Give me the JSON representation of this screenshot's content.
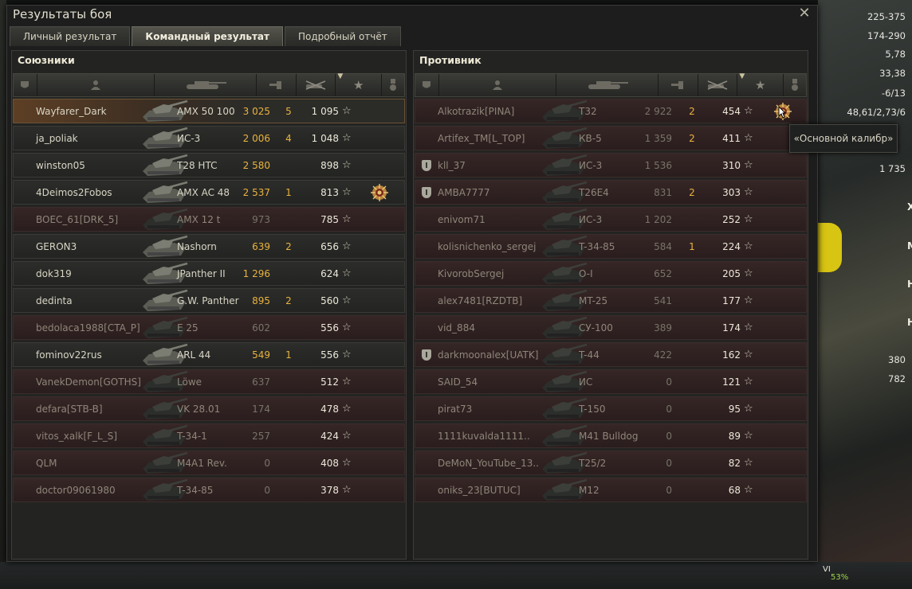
{
  "dialog": {
    "title": "Результаты боя"
  },
  "tabs": [
    {
      "label": "Личный результат",
      "active": false
    },
    {
      "label": "Командный результат",
      "active": true
    },
    {
      "label": "Подробный отчёт",
      "active": false
    }
  ],
  "allies": {
    "title": "Союзники",
    "rows": [
      {
        "name": "Wayfarer_Dark",
        "tank": "AMX 50 100",
        "damage": "3 025",
        "kills": "5",
        "xp": "1 095",
        "status": "me",
        "platoon": false,
        "medal": false
      },
      {
        "name": "ja_poliak",
        "tank": "ИС-3",
        "damage": "2 006",
        "kills": "4",
        "xp": "1 048",
        "status": "alive",
        "platoon": false,
        "medal": false
      },
      {
        "name": "winston05",
        "tank": "T28 HTC",
        "damage": "2 580",
        "kills": "",
        "xp": "898",
        "status": "alive",
        "platoon": false,
        "medal": false
      },
      {
        "name": "4Deimos2Fobos",
        "tank": "AMX AC 48",
        "damage": "2 537",
        "kills": "1",
        "xp": "813",
        "status": "alive",
        "platoon": false,
        "medal": true
      },
      {
        "name": "BOEC_61[DRK_5]",
        "tank": "AMX 12 t",
        "damage": "973",
        "kills": "",
        "xp": "785",
        "status": "dead",
        "platoon": false,
        "medal": false
      },
      {
        "name": "GERON3",
        "tank": "Nashorn",
        "damage": "639",
        "kills": "2",
        "xp": "656",
        "status": "alive",
        "platoon": false,
        "medal": false
      },
      {
        "name": "dok319",
        "tank": "JPanther II",
        "damage": "1 296",
        "kills": "",
        "xp": "624",
        "status": "alive",
        "platoon": false,
        "medal": false
      },
      {
        "name": "dedinta",
        "tank": "G.W. Panther",
        "damage": "895",
        "kills": "2",
        "xp": "560",
        "status": "alive",
        "platoon": false,
        "medal": false
      },
      {
        "name": "bedolaca1988[CTA_P]",
        "tank": "E 25",
        "damage": "602",
        "kills": "",
        "xp": "556",
        "status": "dead",
        "platoon": false,
        "medal": false
      },
      {
        "name": "fominov22rus",
        "tank": "ARL 44",
        "damage": "549",
        "kills": "1",
        "xp": "556",
        "status": "alive",
        "platoon": false,
        "medal": false
      },
      {
        "name": "VanekDemon[GOTHS]",
        "tank": "Löwe",
        "damage": "637",
        "kills": "",
        "xp": "512",
        "status": "dead",
        "platoon": false,
        "medal": false
      },
      {
        "name": "defara[STB-B]",
        "tank": "VK 28.01",
        "damage": "174",
        "kills": "",
        "xp": "478",
        "status": "dead",
        "platoon": false,
        "medal": false
      },
      {
        "name": "vitos_xalk[F_L_S]",
        "tank": "T-34-1",
        "damage": "257",
        "kills": "",
        "xp": "424",
        "status": "dead",
        "platoon": false,
        "medal": false
      },
      {
        "name": "QLM",
        "tank": "M4A1 Rev.",
        "damage": "0",
        "kills": "",
        "xp": "408",
        "status": "dead",
        "platoon": false,
        "medal": false
      },
      {
        "name": "doctor09061980",
        "tank": "T-34-85",
        "damage": "0",
        "kills": "",
        "xp": "378",
        "status": "dead",
        "platoon": false,
        "medal": false
      }
    ]
  },
  "enemies": {
    "title": "Противник",
    "rows": [
      {
        "name": "Alkotrazik[PINA]",
        "tank": "T32",
        "damage": "2 922",
        "kills": "2",
        "xp": "454",
        "status": "dead",
        "platoon": false,
        "medal": true
      },
      {
        "name": "Artifex_TM[L_TOP]",
        "tank": "КВ-5",
        "damage": "1 359",
        "kills": "2",
        "xp": "411",
        "status": "dead",
        "platoon": false,
        "medal": false
      },
      {
        "name": "kll_37",
        "tank": "ИС-3",
        "damage": "1 536",
        "kills": "",
        "xp": "310",
        "status": "dead",
        "platoon": true,
        "medal": false
      },
      {
        "name": "AMBA7777",
        "tank": "T26E4",
        "damage": "831",
        "kills": "2",
        "xp": "303",
        "status": "dead",
        "platoon": true,
        "medal": false
      },
      {
        "name": "enivom71",
        "tank": "ИС-3",
        "damage": "1 202",
        "kills": "",
        "xp": "252",
        "status": "dead",
        "platoon": false,
        "medal": false
      },
      {
        "name": "kolisnichenko_sergej",
        "tank": "T-34-85",
        "damage": "584",
        "kills": "1",
        "xp": "224",
        "status": "dead",
        "platoon": false,
        "medal": false
      },
      {
        "name": "KivorobSergej",
        "tank": "O-I",
        "damage": "652",
        "kills": "",
        "xp": "205",
        "status": "dead",
        "platoon": false,
        "medal": false
      },
      {
        "name": "alex7481[RZDTB]",
        "tank": "MT-25",
        "damage": "541",
        "kills": "",
        "xp": "177",
        "status": "dead",
        "platoon": false,
        "medal": false
      },
      {
        "name": "vid_884",
        "tank": "СУ-100",
        "damage": "389",
        "kills": "",
        "xp": "174",
        "status": "dead",
        "platoon": false,
        "medal": false
      },
      {
        "name": "darkmoonalex[UATK]",
        "tank": "T-44",
        "damage": "422",
        "kills": "",
        "xp": "162",
        "status": "dead",
        "platoon": true,
        "medal": false
      },
      {
        "name": "SAID_54",
        "tank": "ИС",
        "damage": "0",
        "kills": "",
        "xp": "121",
        "status": "dead",
        "platoon": false,
        "medal": false
      },
      {
        "name": "pirat73",
        "tank": "T-150",
        "damage": "0",
        "kills": "",
        "xp": "95",
        "status": "dead",
        "platoon": false,
        "medal": false
      },
      {
        "name": "1111kuvalda1111..",
        "tank": "M41 Bulldog",
        "damage": "0",
        "kills": "",
        "xp": "89",
        "status": "dead",
        "platoon": false,
        "medal": false
      },
      {
        "name": "DeMoN_YouTube_13..",
        "tank": "T25/2",
        "damage": "0",
        "kills": "",
        "xp": "82",
        "status": "dead",
        "platoon": false,
        "medal": false
      },
      {
        "name": "oniks_23[BUTUC]",
        "tank": "M12",
        "damage": "0",
        "kills": "",
        "xp": "68",
        "status": "dead",
        "platoon": false,
        "medal": false
      }
    ]
  },
  "tooltip": {
    "text": "«Основной калибр»"
  },
  "background": {
    "readouts": [
      "225-375",
      "174-290",
      "5,78",
      "33,38",
      "-6/13",
      "48,61/2,73/6",
      "1 735",
      "380",
      "782"
    ],
    "arrows": [
      "Х",
      "М",
      "Н",
      "Н"
    ],
    "badge": "VI",
    "percent": "53%"
  }
}
